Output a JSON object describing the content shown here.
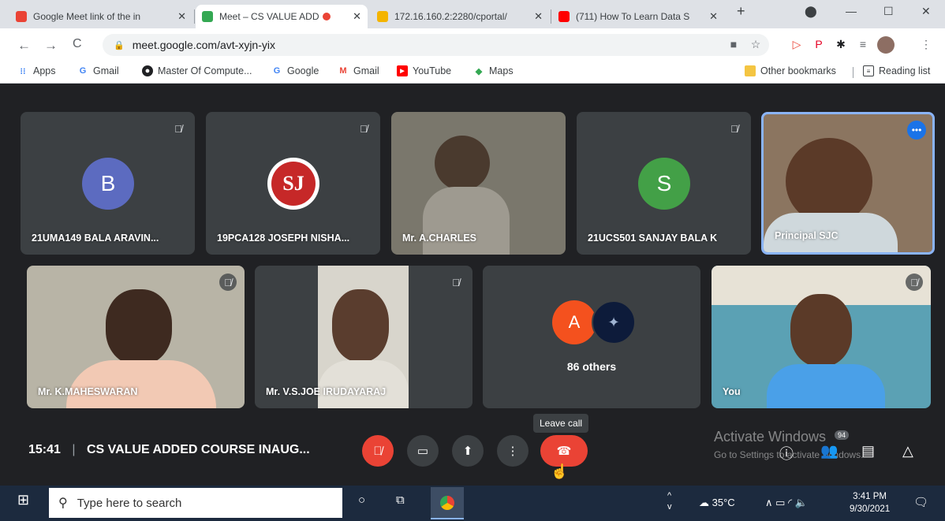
{
  "browser": {
    "tabs": [
      {
        "label": "Google Meet link of the in",
        "color": "#ea4335"
      },
      {
        "label": "Meet – CS VALUE ADD",
        "color": "#34a853"
      },
      {
        "label": "172.16.160.2:2280/cportal/",
        "color": "#f4b400"
      },
      {
        "label": "(711) How To Learn Data S",
        "color": "#ff0000"
      }
    ],
    "new_tab": "+",
    "address": "meet.google.com/avt-xyjn-yix",
    "bookmarks": [
      {
        "label": "Apps",
        "icon": "apps-icon"
      },
      {
        "label": "Gmail",
        "icon": "google-icon"
      },
      {
        "label": "Master Of Compute...",
        "icon": "github-icon"
      },
      {
        "label": "Google",
        "icon": "google-icon"
      },
      {
        "label": "Gmail",
        "icon": "gmail-icon"
      },
      {
        "label": "YouTube",
        "icon": "youtube-icon"
      },
      {
        "label": "Maps",
        "icon": "maps-icon"
      }
    ],
    "other_bookmarks": "Other bookmarks",
    "reading_list": "Reading list"
  },
  "participants": [
    {
      "name": "21UMA149 BALA ARAVIN...",
      "avatar": "B",
      "avatar_color": "#5c6bc0"
    },
    {
      "name": "19PCA128 JOSEPH NISHA...",
      "avatar": "SJ",
      "avatar_color": "#ffffff"
    },
    {
      "name": "Mr. A.CHARLES"
    },
    {
      "name": "21UCS501 SANJAY BALA K",
      "avatar": "S",
      "avatar_color": "#43a047"
    },
    {
      "name": "Principal SJC"
    },
    {
      "name": "Mr. K.MAHESWARAN"
    },
    {
      "name": "Mr. V.S.JOE IRUDAYARAJ"
    },
    {
      "name": "86 others",
      "avatar": "A",
      "avatar_color": "#f4511e"
    },
    {
      "name": "You"
    }
  ],
  "meeting": {
    "time": "15:41",
    "separator": "|",
    "title": "CS VALUE ADDED COURSE INAUG...",
    "tooltip": "Leave call",
    "people_count": "94"
  },
  "watermark": {
    "line1": "Activate Windows",
    "line2": "Go to Settings to activate Windows."
  },
  "taskbar": {
    "search_placeholder": "Type here to search",
    "temperature": "35°C",
    "time": "3:41 PM",
    "date": "9/30/2021"
  }
}
